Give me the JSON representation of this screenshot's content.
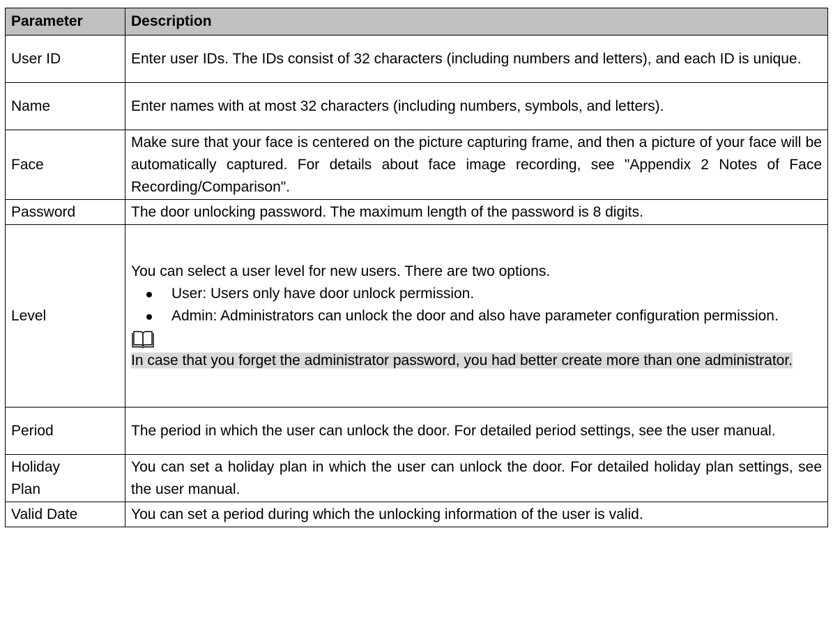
{
  "table": {
    "headers": {
      "parameter": "Parameter",
      "description": "Description"
    },
    "rows": [
      {
        "name": "User ID",
        "desc": "Enter user IDs. The IDs consist of 32 characters (including numbers and letters), and each ID is unique."
      },
      {
        "name": "Name",
        "desc": "Enter names with at most 32 characters (including numbers, symbols, and letters)."
      },
      {
        "name": "Face",
        "desc": "Make sure that your face is centered on the picture capturing frame, and then a picture of your face will be automatically captured. For details about face image recording, see \"Appendix 2 Notes of Face Recording/Comparison\"."
      },
      {
        "name": "Password",
        "desc": "The door unlocking password. The maximum length of the password is 8 digits."
      },
      {
        "name": "Level",
        "intro": "You can select a user level for new users. There are two options.",
        "bullets": [
          "User: Users only have door unlock permission.",
          "Admin: Administrators can unlock the door and also have parameter configuration permission."
        ],
        "note_icon": "book-note-icon",
        "note": "In case that you forget the administrator password, you had better create more than one administrator."
      },
      {
        "name": "Period",
        "desc": "The period in which the user can unlock the door. For detailed period settings, see the user manual."
      },
      {
        "name_line1": "Holiday",
        "name_line2": "Plan",
        "desc": "You can set a holiday plan in which the user can unlock the door. For detailed holiday plan settings, see the user manual."
      },
      {
        "name": "Valid Date",
        "desc": "You can set a period during which the unlocking information of the user is valid."
      }
    ]
  },
  "colors": {
    "header_bg": "#c0c0c0",
    "note_highlight": "#d9d9d9",
    "border": "#000000"
  }
}
